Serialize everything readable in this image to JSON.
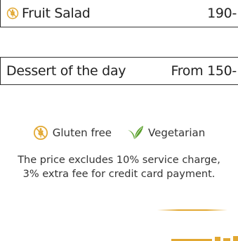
{
  "menu": {
    "items": [
      {
        "name": "Fruit Salad",
        "price": "190-",
        "icon": "gluten-free-icon"
      },
      {
        "name": "Dessert of the day",
        "price": "From 150-"
      }
    ]
  },
  "legend": {
    "gluten_free": {
      "label": "Gluten free",
      "icon": "gluten-free-icon"
    },
    "vegetarian": {
      "label": "Vegetarian",
      "icon": "leaf-icon"
    }
  },
  "note": {
    "line1": "The price excludes 10% service charge,",
    "line2": "3% extra fee for credit card payment."
  },
  "colors": {
    "gold": "#e2a832",
    "green": "#5aa02c",
    "text": "#222222",
    "border": "#333333"
  }
}
